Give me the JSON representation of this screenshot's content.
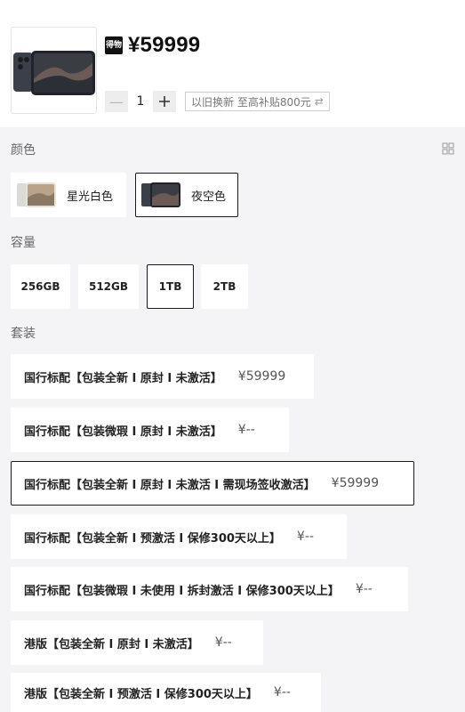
{
  "product": {
    "badge_text": "得物",
    "price": "¥59999",
    "quantity": "1",
    "minus_symbol": "—",
    "plus_symbol": "+",
    "trade_in_label": "以旧换新 至高补贴800元",
    "trade_in_icon": "swap-arrows-icon"
  },
  "colors": {
    "title": "颜色",
    "options": [
      {
        "label": "星光白色",
        "selected": false
      },
      {
        "label": "夜空色",
        "selected": true
      }
    ]
  },
  "capacity": {
    "title": "容量",
    "options": [
      {
        "label": "256GB",
        "selected": false
      },
      {
        "label": "512GB",
        "selected": false
      },
      {
        "label": "1TB",
        "selected": true
      },
      {
        "label": "2TB",
        "selected": false
      }
    ]
  },
  "packages": {
    "title": "套装",
    "options": [
      {
        "label": "国行标配【包装全新 I 原封 I 未激活】",
        "price": "¥59999",
        "selected": false
      },
      {
        "label": "国行标配【包装微瑕 I 原封 I 未激活】",
        "price": "¥--",
        "selected": false
      },
      {
        "label": "国行标配【包装全新 I 原封 I 未激活 I 需现场签收激活】",
        "price": "¥59999",
        "selected": true
      },
      {
        "label": "国行标配【包装全新 I 预激活 I 保修300天以上】",
        "price": "¥--",
        "selected": false
      },
      {
        "label": "国行标配【包装微瑕 I 未使用 I 拆封激活 I 保修300天以上】",
        "price": "¥--",
        "selected": false
      },
      {
        "label": "港版【包装全新 I 原封 I 未激活】",
        "price": "¥--",
        "selected": false
      },
      {
        "label": "港版【包装全新 I 预激活 I 保修300天以上】",
        "price": "¥--",
        "selected": false
      }
    ]
  },
  "theme": {
    "page_bg": "#f4f4f6",
    "selected_border": "#1a1a1a",
    "phone_dark": "#2b2f3a"
  }
}
